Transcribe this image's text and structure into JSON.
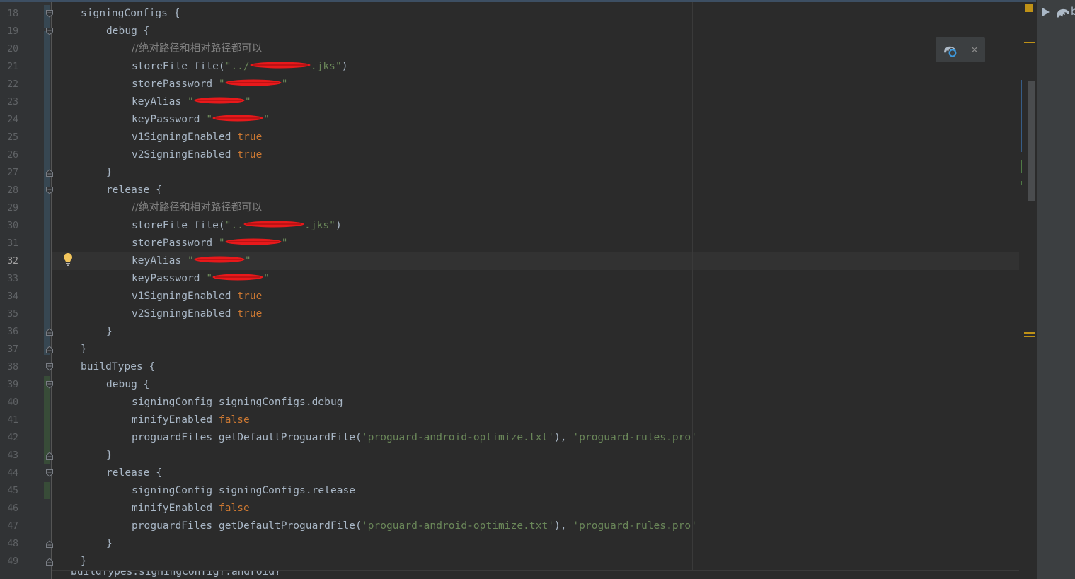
{
  "editor": {
    "language": "groovy",
    "current_line": 32,
    "lines": [
      {
        "n": 18,
        "indent": 0,
        "segments": [
          {
            "t": "signingConfigs {",
            "c": "id"
          }
        ]
      },
      {
        "n": 19,
        "indent": 1,
        "segments": [
          {
            "t": "debug {",
            "c": "id"
          }
        ]
      },
      {
        "n": 20,
        "indent": 2,
        "segments": [
          {
            "t": "//绝对路径和相对路径都可以",
            "c": "cm"
          }
        ]
      },
      {
        "n": 21,
        "indent": 2,
        "segments": [
          {
            "t": "storeFile file(",
            "c": "id"
          },
          {
            "t": "\"../",
            "c": "str"
          },
          {
            "redact": 86,
            "c": "str"
          },
          {
            "t": ".jks\"",
            "c": "str"
          },
          {
            "t": ")",
            "c": "id"
          }
        ]
      },
      {
        "n": 22,
        "indent": 2,
        "segments": [
          {
            "t": "storePassword ",
            "c": "id"
          },
          {
            "t": "\"",
            "c": "str"
          },
          {
            "redact": 80,
            "c": "str"
          },
          {
            "t": "\"",
            "c": "str"
          }
        ]
      },
      {
        "n": 23,
        "indent": 2,
        "segments": [
          {
            "t": "keyAlias ",
            "c": "id"
          },
          {
            "t": "\"",
            "c": "str"
          },
          {
            "redact": 72,
            "c": "str"
          },
          {
            "t": "\"",
            "c": "str"
          }
        ]
      },
      {
        "n": 24,
        "indent": 2,
        "segments": [
          {
            "t": "keyPassword ",
            "c": "id"
          },
          {
            "t": "\"",
            "c": "str"
          },
          {
            "redact": 72,
            "c": "str"
          },
          {
            "t": "\"",
            "c": "str"
          }
        ]
      },
      {
        "n": 25,
        "indent": 2,
        "segments": [
          {
            "t": "v1SigningEnabled ",
            "c": "id"
          },
          {
            "t": "true",
            "c": "kw"
          }
        ]
      },
      {
        "n": 26,
        "indent": 2,
        "segments": [
          {
            "t": "v2SigningEnabled ",
            "c": "id"
          },
          {
            "t": "true",
            "c": "kw"
          }
        ]
      },
      {
        "n": 27,
        "indent": 1,
        "segments": [
          {
            "t": "}",
            "c": "id"
          }
        ]
      },
      {
        "n": 28,
        "indent": 1,
        "segments": [
          {
            "t": "release {",
            "c": "id"
          }
        ]
      },
      {
        "n": 29,
        "indent": 2,
        "segments": [
          {
            "t": "//绝对路径和相对路径都可以",
            "c": "cm"
          }
        ]
      },
      {
        "n": 30,
        "indent": 2,
        "segments": [
          {
            "t": "storeFile file(",
            "c": "id"
          },
          {
            "t": "\"..",
            "c": "str"
          },
          {
            "redact": 86,
            "c": "str"
          },
          {
            "t": ".jks\"",
            "c": "str"
          },
          {
            "t": ")",
            "c": "id"
          }
        ]
      },
      {
        "n": 31,
        "indent": 2,
        "segments": [
          {
            "t": "storePassword ",
            "c": "id"
          },
          {
            "t": "\"",
            "c": "str"
          },
          {
            "redact": 80,
            "c": "str"
          },
          {
            "t": "\"",
            "c": "str"
          }
        ]
      },
      {
        "n": 32,
        "indent": 2,
        "segments": [
          {
            "t": "keyAlias ",
            "c": "id"
          },
          {
            "t": "\"",
            "c": "str"
          },
          {
            "redact": 72,
            "c": "str"
          },
          {
            "t": "\"",
            "c": "str"
          }
        ]
      },
      {
        "n": 33,
        "indent": 2,
        "segments": [
          {
            "t": "keyPassword ",
            "c": "id"
          },
          {
            "t": "\"",
            "c": "str"
          },
          {
            "redact": 72,
            "c": "str"
          },
          {
            "t": "\"",
            "c": "str"
          }
        ]
      },
      {
        "n": 34,
        "indent": 2,
        "segments": [
          {
            "t": "v1SigningEnabled ",
            "c": "id"
          },
          {
            "t": "true",
            "c": "kw"
          }
        ]
      },
      {
        "n": 35,
        "indent": 2,
        "segments": [
          {
            "t": "v2SigningEnabled ",
            "c": "id"
          },
          {
            "t": "true",
            "c": "kw"
          }
        ]
      },
      {
        "n": 36,
        "indent": 1,
        "segments": [
          {
            "t": "}",
            "c": "id"
          }
        ]
      },
      {
        "n": 37,
        "indent": 0,
        "segments": [
          {
            "t": "}",
            "c": "id"
          }
        ]
      },
      {
        "n": 38,
        "indent": 0,
        "segments": [
          {
            "t": "buildTypes {",
            "c": "id"
          }
        ]
      },
      {
        "n": 39,
        "indent": 1,
        "segments": [
          {
            "t": "debug {",
            "c": "id"
          }
        ]
      },
      {
        "n": 40,
        "indent": 2,
        "segments": [
          {
            "t": "signingConfig signingConfigs.debug",
            "c": "id"
          }
        ]
      },
      {
        "n": 41,
        "indent": 2,
        "segments": [
          {
            "t": "minifyEnabled ",
            "c": "id"
          },
          {
            "t": "false",
            "c": "kw"
          }
        ]
      },
      {
        "n": 42,
        "indent": 2,
        "segments": [
          {
            "t": "proguardFiles getDefaultProguardFile(",
            "c": "id"
          },
          {
            "t": "'proguard-android-optimize.txt'",
            "c": "str"
          },
          {
            "t": "), ",
            "c": "id"
          },
          {
            "t": "'proguard-rules.pro'",
            "c": "str"
          }
        ]
      },
      {
        "n": 43,
        "indent": 1,
        "segments": [
          {
            "t": "}",
            "c": "id"
          }
        ]
      },
      {
        "n": 44,
        "indent": 1,
        "segments": [
          {
            "t": "release {",
            "c": "id"
          }
        ]
      },
      {
        "n": 45,
        "indent": 2,
        "segments": [
          {
            "t": "signingConfig signingConfigs.release",
            "c": "id"
          }
        ]
      },
      {
        "n": 46,
        "indent": 2,
        "segments": [
          {
            "t": "minifyEnabled ",
            "c": "id"
          },
          {
            "t": "false",
            "c": "kw"
          }
        ]
      },
      {
        "n": 47,
        "indent": 2,
        "segments": [
          {
            "t": "proguardFiles getDefaultProguardFile(",
            "c": "id"
          },
          {
            "t": "'proguard-android-optimize.txt'",
            "c": "str"
          },
          {
            "t": "), ",
            "c": "id"
          },
          {
            "t": "'proguard-rules.pro'",
            "c": "str"
          }
        ]
      },
      {
        "n": 48,
        "indent": 1,
        "segments": [
          {
            "t": "}",
            "c": "id"
          }
        ]
      },
      {
        "n": 49,
        "indent": 0,
        "segments": [
          {
            "t": "}",
            "c": "id"
          }
        ]
      }
    ],
    "fold_open_lines": [
      18,
      19,
      28,
      38,
      39,
      44
    ],
    "fold_close_lines": [
      27,
      36,
      37,
      43,
      48,
      49
    ],
    "intention_bulb_line": 32,
    "partial_next_line": "buildTypes.signingConfig?.android?"
  },
  "gradle_popup": {
    "icon": "gradle-sync-icon",
    "close_label": "×"
  },
  "right_toolbar": {
    "run_icon": "run-triangle-icon",
    "tool_icon": "gradle-elephant-icon",
    "label": "b"
  },
  "colors": {
    "background": "#2b2b2b",
    "identifier": "#a9b7c6",
    "string": "#6a8759",
    "keyword": "#cc7832",
    "comment": "#808080",
    "redaction": "#e8191b",
    "warning_marker": "#be9117"
  }
}
